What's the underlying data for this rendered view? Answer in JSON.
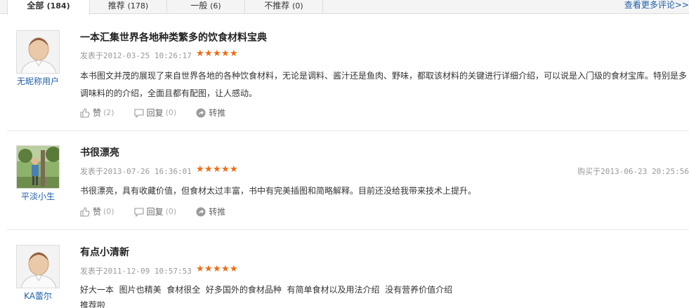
{
  "tabs": [
    {
      "label": "全部",
      "count": "(184)"
    },
    {
      "label": "推荐",
      "count": "(178)"
    },
    {
      "label": "一般",
      "count": "(6)"
    },
    {
      "label": "不推荐",
      "count": "(0)"
    }
  ],
  "more_link": "查看更多评论>>",
  "reviews": [
    {
      "username": "无昵称用户",
      "avatar": "default-avatar-icon",
      "title": "一本汇集世界各地种类繁多的饮食材料宝典",
      "posted": "发表于2012-03-25 10:26:17",
      "rating": 5,
      "bought": "",
      "content": [
        "本书图文并茂的展现了来自世界各地的各种饮食材料，无论是调料、酱汁还是鱼肉、野味，都取该材料的关键进行详细介绍，可以说是入门级的食材宝库。特别是多",
        "调味料的的介绍，全面且都有配图，让人感动。"
      ],
      "like_label": "赞",
      "like_count": "(2)",
      "reply_label": "回复",
      "reply_count": "(0)",
      "share_label": "转推"
    },
    {
      "username": "平淡小生",
      "avatar": "user-photo-avatar",
      "title": "书很漂亮",
      "posted": "发表于2013-07-26 16:36:01",
      "rating": 5,
      "bought": "购买于2013-06-23 20:25:56",
      "content": [
        "书很漂亮，具有收藏价值，但食材太过丰富，书中有完美插图和简略解释。目前还没给我带来技术上提升。"
      ],
      "like_label": "赞",
      "like_count": "(0)",
      "reply_label": "回复",
      "reply_count": "(0)",
      "share_label": "转推"
    },
    {
      "username": "KA蕾尔",
      "avatar": "default-avatar-icon",
      "title": "有点小清新",
      "posted": "发表于2011-12-09 10:57:53",
      "rating": 5,
      "bought": "",
      "content": [
        "好大一本  图片也精美  食材很全  好多国外的食材品种  有简单食材以及用法介绍  没有营养价值介绍",
        "推荐啦"
      ],
      "like_label": "",
      "like_count": "",
      "reply_label": "",
      "reply_count": "",
      "share_label": ""
    }
  ],
  "colors": {
    "star": "#f06a0f",
    "link": "#1f5fa8",
    "meta": "#999999"
  }
}
